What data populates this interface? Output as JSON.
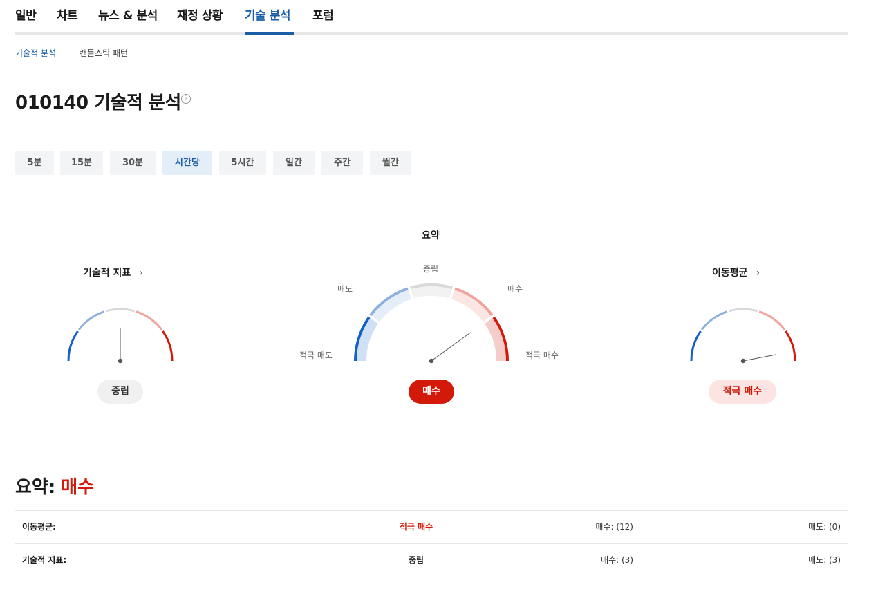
{
  "tabs": [
    "일반",
    "차트",
    "뉴스 & 분석",
    "재정 상황",
    "기술 분석",
    "포럼"
  ],
  "active_tab": "기술 분석",
  "subtabs": [
    "기술적 분석",
    "캔들스틱 패턴"
  ],
  "page_title": "010140 기술적 분석",
  "periods": [
    "5분",
    "15분",
    "30분",
    "시간당",
    "5시간",
    "일간",
    "주간",
    "월간"
  ],
  "active_period": "시간당",
  "colors": {
    "strong_sell": "#1360c7",
    "sell": "#8fb0dc",
    "neutral": "#d9d9d9",
    "buy": "#f0a39c",
    "strong_buy": "#d31a0a",
    "accent": "#1b5ea8"
  },
  "gauges": {
    "indicators": {
      "title": "기술적 지표",
      "result": "중립",
      "needle_value": 0.5
    },
    "summary": {
      "title": "요약",
      "result": "매수",
      "needle_value": 0.8,
      "labels": {
        "strong_sell": "적극 매도",
        "sell": "매도",
        "neutral": "중립",
        "buy": "매수",
        "strong_buy": "적극 매수"
      }
    },
    "moving_averages": {
      "title": "이동평균",
      "result": "적극 매수",
      "needle_value": 0.94
    }
  },
  "summary": {
    "heading": "요약:",
    "value": "매수",
    "rows": [
      {
        "name": "이동평균:",
        "signal": "적극 매수",
        "buy": "매수: (12)",
        "sell": "매도: (0)"
      },
      {
        "name": "기술적 지표:",
        "signal": "중립",
        "buy": "매수: (3)",
        "sell": "매도: (3)"
      }
    ]
  }
}
